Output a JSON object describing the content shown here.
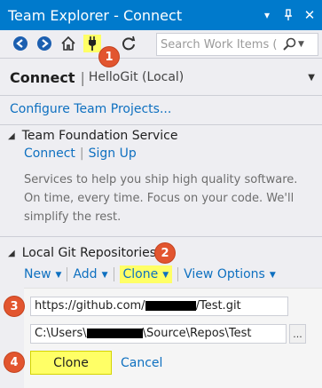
{
  "window": {
    "title": "Team Explorer - Connect",
    "controls": [
      "dropdown",
      "pin",
      "close"
    ]
  },
  "toolbar": {
    "search_placeholder": "Search Work Items (",
    "icons": [
      "back-icon",
      "forward-icon",
      "home-icon",
      "connect-plug-icon",
      "refresh-icon"
    ]
  },
  "header": {
    "title": "Connect",
    "separator": "|",
    "subtitle": "HelloGit (Local)"
  },
  "configure_link": "Configure Team Projects...",
  "tfs_section": {
    "title": "Team Foundation Service",
    "connect_link": "Connect",
    "separator": "|",
    "signup_link": "Sign Up",
    "description": "Services to help you ship high quality software. On time, every time. Focus on your code. We'll simplify the rest."
  },
  "git_section": {
    "title": "Local Git Repositories",
    "actions": {
      "new": "New",
      "add": "Add",
      "clone": "Clone",
      "view_options": "View Options"
    }
  },
  "clone_form": {
    "url_prefix": "https://github.com/",
    "url_suffix": "/Test.git",
    "path_prefix": "C:\\Users\\",
    "path_suffix": "\\Source\\Repos\\Test",
    "browse_label": "...",
    "clone_button": "Clone",
    "cancel_link": "Cancel"
  },
  "annotations": {
    "step1": "1",
    "step2": "2",
    "step3": "3",
    "step4": "4"
  },
  "colors": {
    "titlebar": "#007acc",
    "link": "#0e70c0",
    "highlight": "#ffff66",
    "badge": "#e2552f"
  }
}
